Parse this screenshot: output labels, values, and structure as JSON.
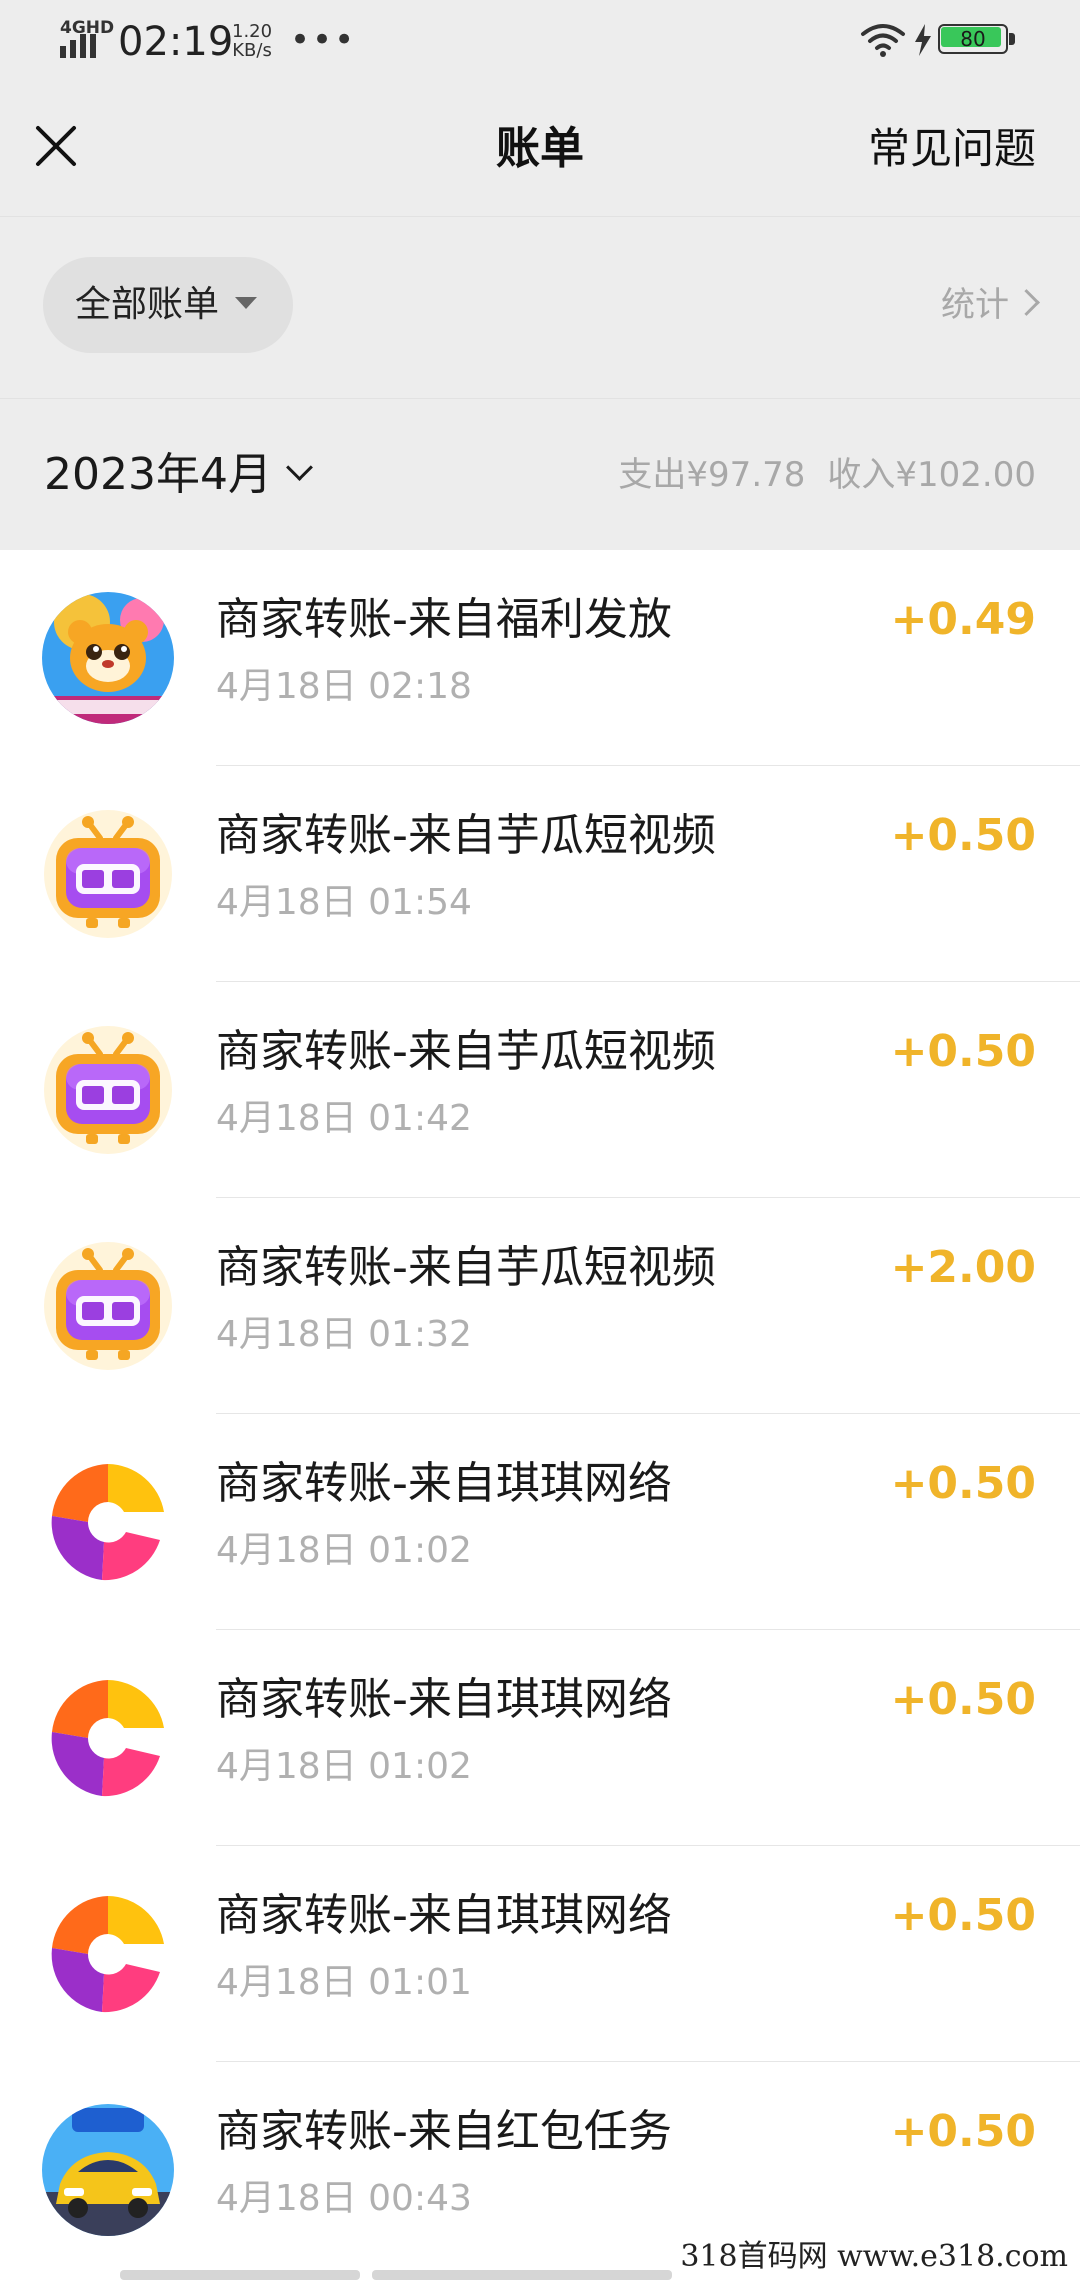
{
  "status_bar": {
    "network": "4GHD",
    "time": "02:19",
    "speed_value": "1.20",
    "speed_unit": "KB/s",
    "more": "•••",
    "battery": "80"
  },
  "header": {
    "title": "账单",
    "faq_label": "常见问题",
    "close_icon": "close-icon"
  },
  "filter": {
    "label": "全部账单",
    "stats_label": "统计"
  },
  "month": {
    "label": "2023年4月",
    "expense": "支出¥97.78",
    "income": "收入¥102.00"
  },
  "transactions": [
    {
      "title": "商家转账-来自福利发放",
      "time": "4月18日 02:18",
      "amount": "+0.49",
      "icon": "tiger-game-icon"
    },
    {
      "title": "商家转账-来自芋瓜短视频",
      "time": "4月18日 01:54",
      "amount": "+0.50",
      "icon": "kandian-tv-icon"
    },
    {
      "title": "商家转账-来自芋瓜短视频",
      "time": "4月18日 01:42",
      "amount": "+0.50",
      "icon": "kandian-tv-icon"
    },
    {
      "title": "商家转账-来自芋瓜短视频",
      "time": "4月18日 01:32",
      "amount": "+2.00",
      "icon": "kandian-tv-icon"
    },
    {
      "title": "商家转账-来自琪琪网络",
      "time": "4月18日 01:02",
      "amount": "+0.50",
      "icon": "qiqi-logo-icon"
    },
    {
      "title": "商家转账-来自琪琪网络",
      "time": "4月18日 01:02",
      "amount": "+0.50",
      "icon": "qiqi-logo-icon"
    },
    {
      "title": "商家转账-来自琪琪网络",
      "time": "4月18日 01:01",
      "amount": "+0.50",
      "icon": "qiqi-logo-icon"
    },
    {
      "title": "商家转账-来自红包任务",
      "time": "4月18日 00:43",
      "amount": "+0.50",
      "icon": "car-2048-icon"
    }
  ],
  "colors": {
    "amount": "#f0b42a",
    "background": "#ededed",
    "battery": "#39c75a"
  },
  "watermark": "318首码网 www.e318.com"
}
